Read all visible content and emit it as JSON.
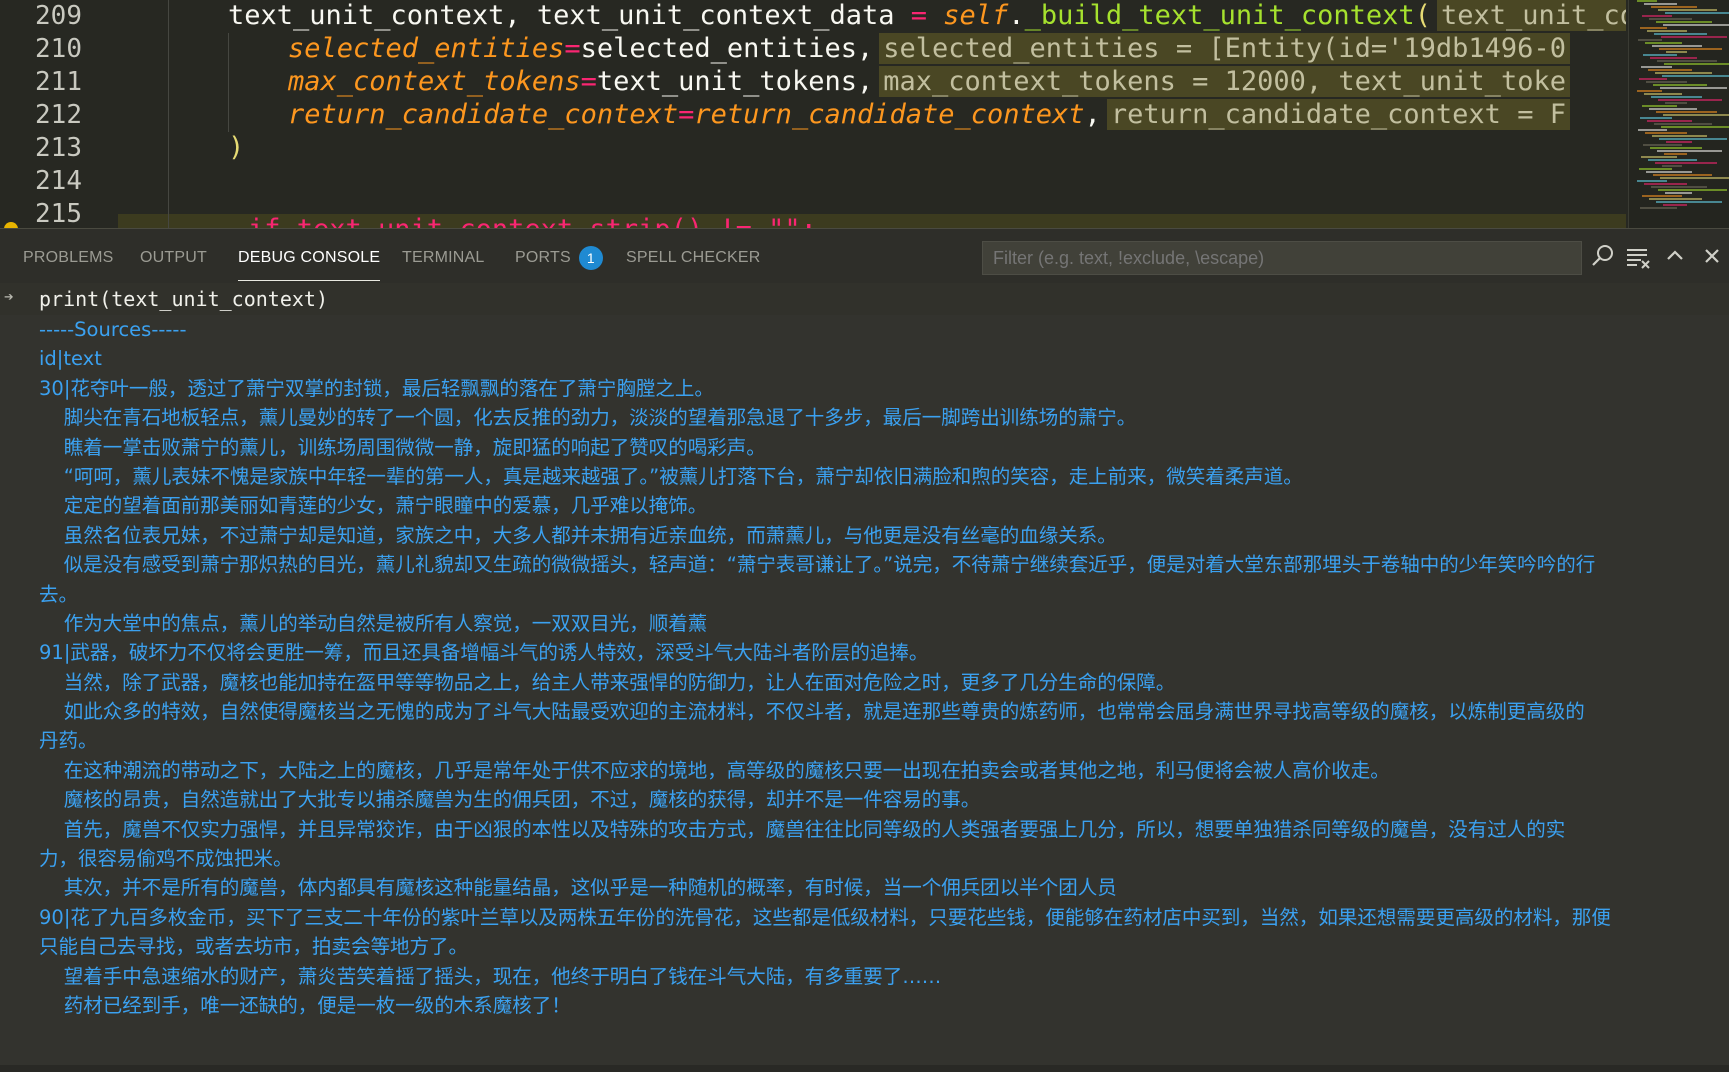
{
  "editor": {
    "line_numbers": [
      "209",
      "210",
      "211",
      "212",
      "213",
      "214",
      "215"
    ],
    "lines": [
      {
        "parts": [
          {
            "t": "text_unit_context",
            "c": "punc"
          },
          {
            "t": ", ",
            "c": "punc"
          },
          {
            "t": "text_unit_context_data",
            "c": "punc"
          },
          {
            "t": " = ",
            "c": "op"
          },
          {
            "t": "self",
            "c": "kw-self"
          },
          {
            "t": ".",
            "c": "punc"
          },
          {
            "t": "_build_text_unit_context",
            "c": "fn"
          },
          {
            "t": "(",
            "c": "paren"
          }
        ],
        "hint": "text_unit_context"
      },
      {
        "parts": [
          {
            "t": "selected_entities",
            "c": "param"
          },
          {
            "t": "=",
            "c": "op"
          },
          {
            "t": "selected_entities",
            "c": "punc"
          },
          {
            "t": ",",
            "c": "punc"
          }
        ],
        "hint": "selected_entities = [Entity(id='19db1496-0"
      },
      {
        "parts": [
          {
            "t": "max_context_tokens",
            "c": "param"
          },
          {
            "t": "=",
            "c": "op"
          },
          {
            "t": "text_unit_tokens",
            "c": "punc"
          },
          {
            "t": ",",
            "c": "punc"
          }
        ],
        "hint": "max_context_tokens = 12000, text_unit_toke"
      },
      {
        "parts": [
          {
            "t": "return_candidate_context",
            "c": "param"
          },
          {
            "t": "=",
            "c": "op"
          },
          {
            "t": "return_candidate_context",
            "c": "param"
          },
          {
            "t": ",",
            "c": "punc"
          }
        ],
        "hint": "return_candidate_context = F"
      },
      {
        "parts": [
          {
            "t": ")",
            "c": "paren"
          }
        ],
        "hint": ""
      },
      {
        "parts": [],
        "hint": ""
      }
    ],
    "cut_line": "if text_unit_context.strip() != \"\":"
  },
  "panel": {
    "tabs": [
      {
        "label": "PROBLEMS",
        "active": false
      },
      {
        "label": "OUTPUT",
        "active": false
      },
      {
        "label": "DEBUG CONSOLE",
        "active": true
      },
      {
        "label": "TERMINAL",
        "active": false
      },
      {
        "label": "PORTS",
        "active": false,
        "badge": "1"
      },
      {
        "label": "SPELL CHECKER",
        "active": false
      }
    ],
    "filter_placeholder": "Filter (e.g. text, !exclude, \\escape)",
    "icons": [
      "search-icon",
      "clear-console-icon",
      "maximize-panel-icon",
      "close-panel-icon"
    ]
  },
  "console": {
    "input": "print(text_unit_context)",
    "output_lines": [
      "-----Sources-----",
      "id|text",
      "30|花夺叶一般，透过了萧宁双掌的封锁，最后轻飘飘的落在了萧宁胸膛之上。",
      "    脚尖在青石地板轻点，薰儿曼妙的转了一个圆，化去反推的劲力，淡淡的望着那急退了十多步，最后一脚跨出训练场的萧宁。",
      "    瞧着一掌击败萧宁的薰儿，训练场周围微微一静，旋即猛的响起了赞叹的喝彩声。",
      "    “呵呵，薰儿表妹不愧是家族中年轻一辈的第一人，真是越来越强了。”被薰儿打落下台，萧宁却依旧满脸和煦的笑容，走上前来，微笑着柔声道。",
      "    定定的望着面前那美丽如青莲的少女，萧宁眼瞳中的爱慕，几乎难以掩饰。",
      "    虽然名位表兄妹，不过萧宁却是知道，家族之中，大多人都并未拥有近亲血统，而萧薰儿，与他更是没有丝毫的血缘关系。",
      "    似是没有感受到萧宁那炽热的目光，薰儿礼貌却又生疏的微微摇头，轻声道：“萧宁表哥谦让了。”说完，不待萧宁继续套近乎，便是对着大堂东部那埋头于卷轴中的少年笑吟吟的行",
      "去。",
      "    作为大堂中的焦点，薰儿的举动自然是被所有人察觉，一双双目光，顺着薰",
      "91|武器，破坏力不仅将会更胜一筹，而且还具备增幅斗气的诱人特效，深受斗气大陆斗者阶层的追捧。",
      "    当然，除了武器，魔核也能加持在盔甲等等物品之上，给主人带来强悍的防御力，让人在面对危险之时，更多了几分生命的保障。",
      "    如此众多的特效，自然使得魔核当之无愧的成为了斗气大陆最受欢迎的主流材料，不仅斗者，就是连那些尊贵的炼药师，也常常会屈身满世界寻找高等级的魔核，以炼制更高级的",
      "丹药。",
      "    在这种潮流的带动之下，大陆之上的魔核，几乎是常年处于供不应求的境地，高等级的魔核只要一出现在拍卖会或者其他之地，利马便将会被人高价收走。",
      "    魔核的昂贵，自然造就出了大批专以捕杀魔兽为生的佣兵团，不过，魔核的获得，却并不是一件容易的事。",
      "    首先，魔兽不仅实力强悍，并且异常狡诈，由于凶狠的本性以及特殊的攻击方式，魔兽往往比同等级的人类强者要强上几分，所以，想要单独猎杀同等级的魔兽，没有过人的实",
      "力，很容易偷鸡不成蚀把米。",
      "    其次，并不是所有的魔兽，体内都具有魔核这种能量结晶，这似乎是一种随机的概率，有时候，当一个佣兵团以半个团人员",
      "90|花了九百多枚金币，买下了三支二十年份的紫叶兰草以及两株五年份的洗骨花，这些都是低级材料，只要花些钱，便能够在药材店中买到，当然，如果还想需要更高级的材料，那便",
      "只能自己去寻找，或者去坊市，拍卖会等地方了。",
      "    望着手中急速缩水的财产，萧炎苦笑着摇了摇头，现在，他终于明白了钱在斗气大陆，有多重要了……",
      "    药材已经到手，唯一还缺的，便是一枚一级的木系魔核了！"
    ]
  }
}
